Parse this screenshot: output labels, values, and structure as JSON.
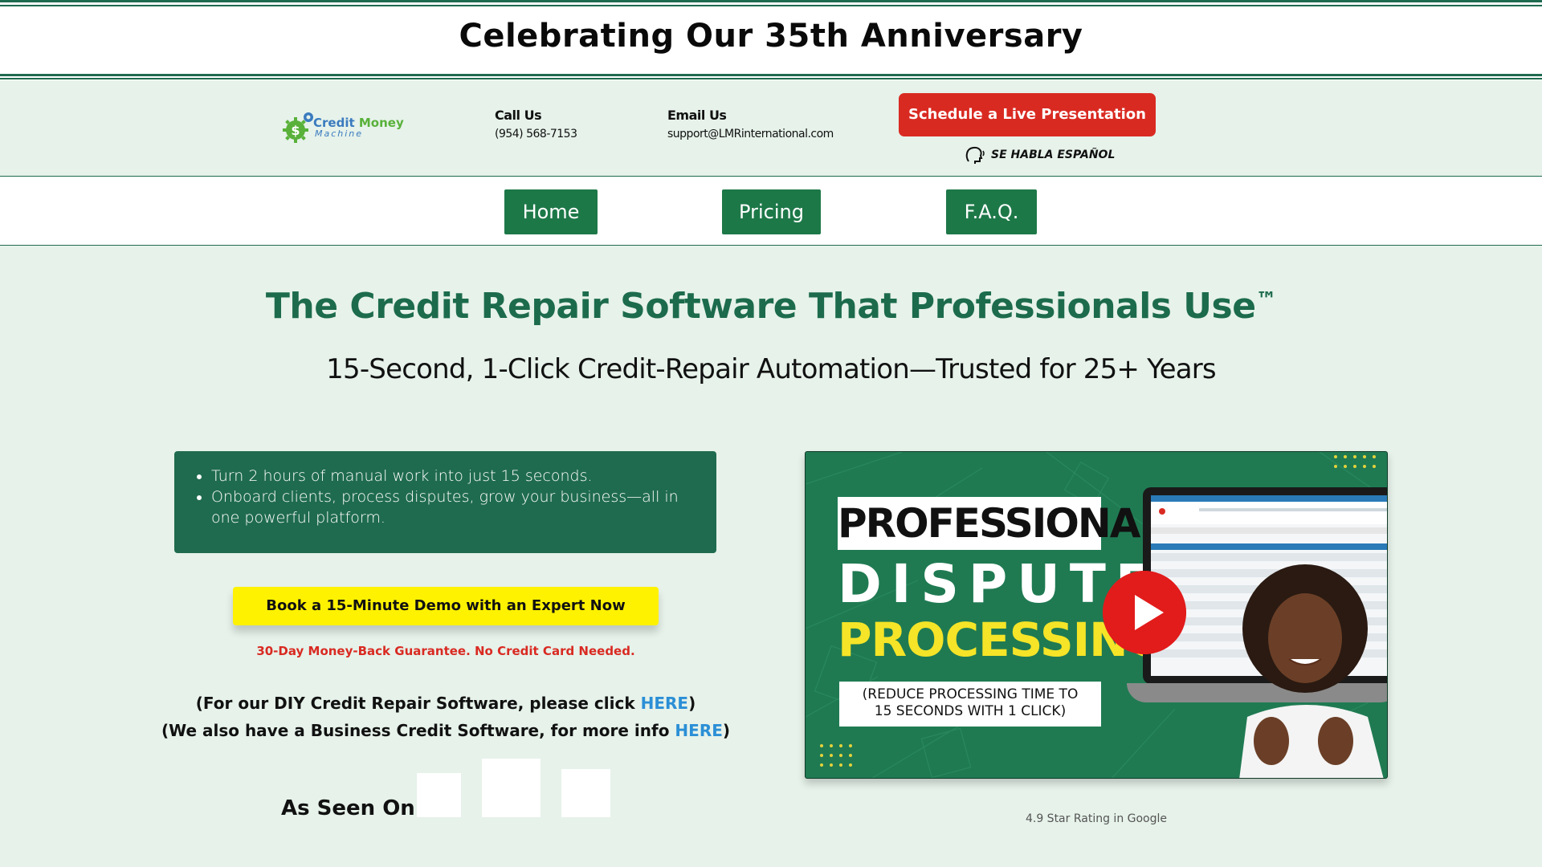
{
  "banner": {
    "title": "Celebrating Our 35th Anniversary"
  },
  "header": {
    "logo": {
      "word1": "Credit",
      "word2": "Money",
      "word3": "Machine"
    },
    "call": {
      "label": "Call Us",
      "value": "(954) 568-7153"
    },
    "email": {
      "label": "Email Us",
      "value": "support@LMRinternational.com"
    },
    "schedule_button": "Schedule a Live Presentation",
    "habla": "SE HABLA ESPAÑOL"
  },
  "nav": {
    "items": [
      {
        "label": "Home"
      },
      {
        "label": "Pricing"
      },
      {
        "label": "F.A.Q."
      }
    ]
  },
  "hero": {
    "title": "The Credit Repair Software That Professionals Use",
    "title_mark": "™",
    "subtitle": "15-Second, 1-Click Credit-Repair Automation—Trusted for 25+ Years"
  },
  "bullets": [
    "Turn 2 hours of manual work into just 15 seconds.",
    "Onboard clients, process disputes, grow your business—all in one powerful platform."
  ],
  "demo_button": "Book a 15-Minute Demo with an Expert Now",
  "guarantee": "30-Day Money-Back Guarantee. No Credit Card Needed.",
  "diy": {
    "line1_pre": "(For our DIY Credit Repair Software, please click ",
    "line1_link": "HERE",
    "line1_post": ")",
    "line2_pre": "(We also have a Business Credit Software, for more info ",
    "line2_link": "HERE",
    "line2_post": ")"
  },
  "as_seen_on": "As Seen On",
  "video": {
    "line1": "PROFESSIONAL",
    "line2": "DISPUTE",
    "line3": "PROCESSING",
    "caption_line1": "(REDUCE PROCESSING TIME TO",
    "caption_line2": "15 SECONDS WITH 1 CLICK)"
  },
  "rating": "4.9 Star Rating in Google",
  "colors": {
    "brand_green": "#1f6b4f",
    "cta_red": "#d92a22",
    "cta_yellow": "#fff200",
    "link_blue": "#2b8fd6"
  }
}
